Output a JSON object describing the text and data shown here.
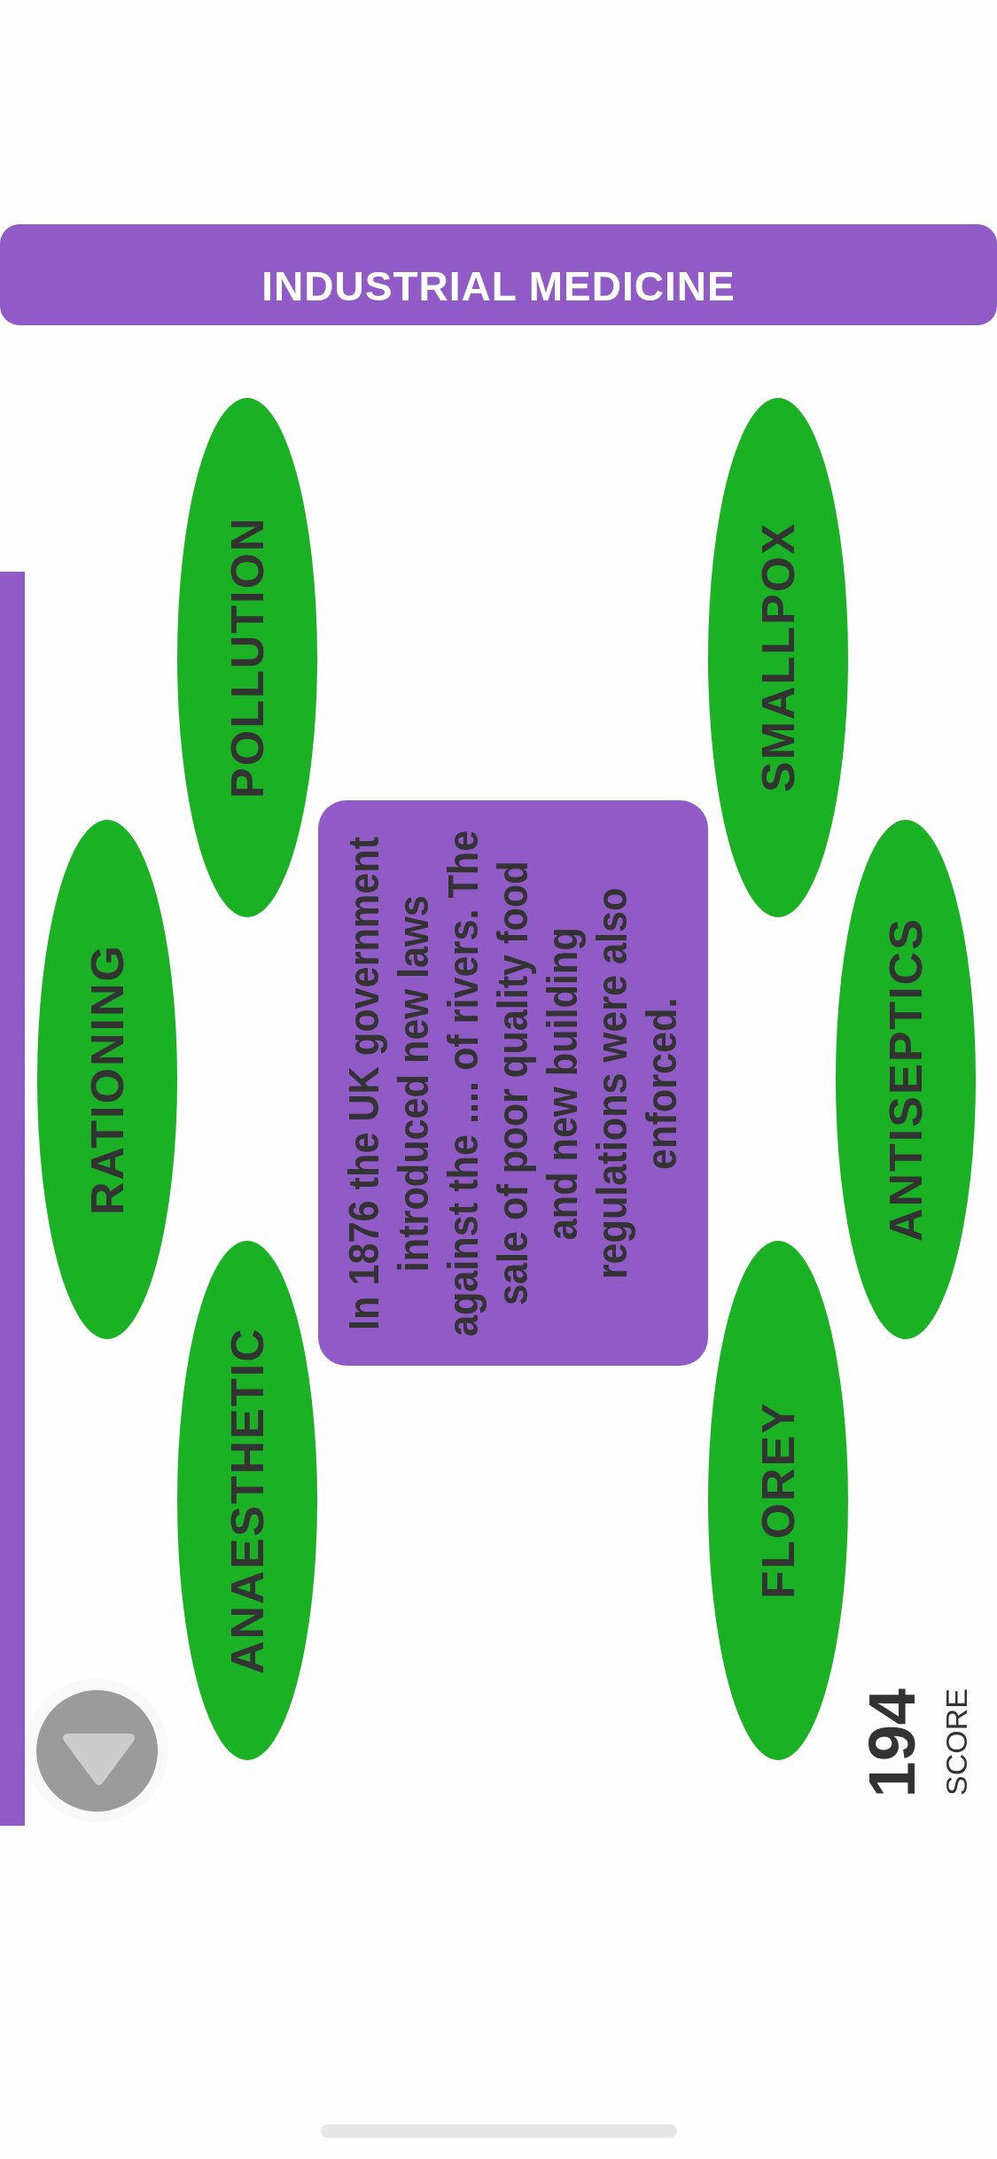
{
  "header": {
    "title": "INDUSTRIAL MEDICINE"
  },
  "question": {
    "text": "In 1876 the UK government\nintroduced new laws\nagainst the .... of rivers. The\nsale of poor quality food\nand new building\nregulations were also\nenforced."
  },
  "options": [
    {
      "label": "RATIONING"
    },
    {
      "label": "POLLUTION"
    },
    {
      "label": "ANAESTHETIC"
    },
    {
      "label": "SMALLPOX"
    },
    {
      "label": "FLOREY"
    },
    {
      "label": "ANTISEPTICS"
    }
  ],
  "score": {
    "value": "194",
    "label": "SCORE"
  }
}
